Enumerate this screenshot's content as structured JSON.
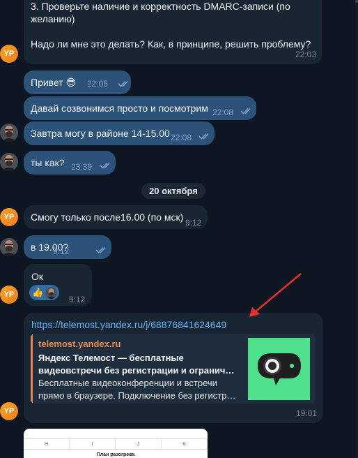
{
  "messages": {
    "m1": {
      "line1": "3. Проверьте наличие и корректность DMARC-записи (по",
      "line2": "желанию)",
      "line3": "Надо ли мне это делать? Как, в принципе, решить проблему?",
      "time": "22:03"
    },
    "m2": {
      "text": "Привет 😎",
      "time": "22:05"
    },
    "m3": {
      "text": "Давай созвонимся просто и посмотрим",
      "time": "22:08"
    },
    "m4": {
      "text": "Завтра могу в районе 14-15.00",
      "time": "22:08"
    },
    "m5": {
      "text": "ты как?",
      "time": "23:39"
    },
    "m6": {
      "text": "Смогу только после16.00 (по мск)",
      "time": "9:12"
    },
    "m7": {
      "text": "в 19.00?",
      "time": "9:12"
    },
    "m8": {
      "text": "Ок",
      "time": "9:12",
      "reaction": "👍"
    },
    "m9": {
      "url": "https://telemost.yandex.ru/j/68876841624649",
      "time": "19:01",
      "preview": {
        "site": "telemost.yandex.ru",
        "title1": "Яндекс Телемост — бесплатные",
        "title2": "видеовстречи без регистрации и огранич…",
        "desc1": "Бесплатные видеоконференции и встречи",
        "desc2": "прямо в браузере. Подключение без регистр…"
      }
    }
  },
  "date_divider": "20 октября",
  "avatar_initials": "YP",
  "sheet": {
    "columns": [
      "H",
      "I",
      "J",
      "K"
    ],
    "title": "План разогрева"
  },
  "icons": {
    "read": "double-check-icon",
    "arrow": "red-arrow-annotation"
  },
  "colors": {
    "background": "#0e1621",
    "incoming": "#182533",
    "outgoing": "#2b5278",
    "link": "#6ab3f3",
    "preview_accent": "#e9874a",
    "avatar": "#f5a623",
    "annotation": "#e8302c"
  }
}
